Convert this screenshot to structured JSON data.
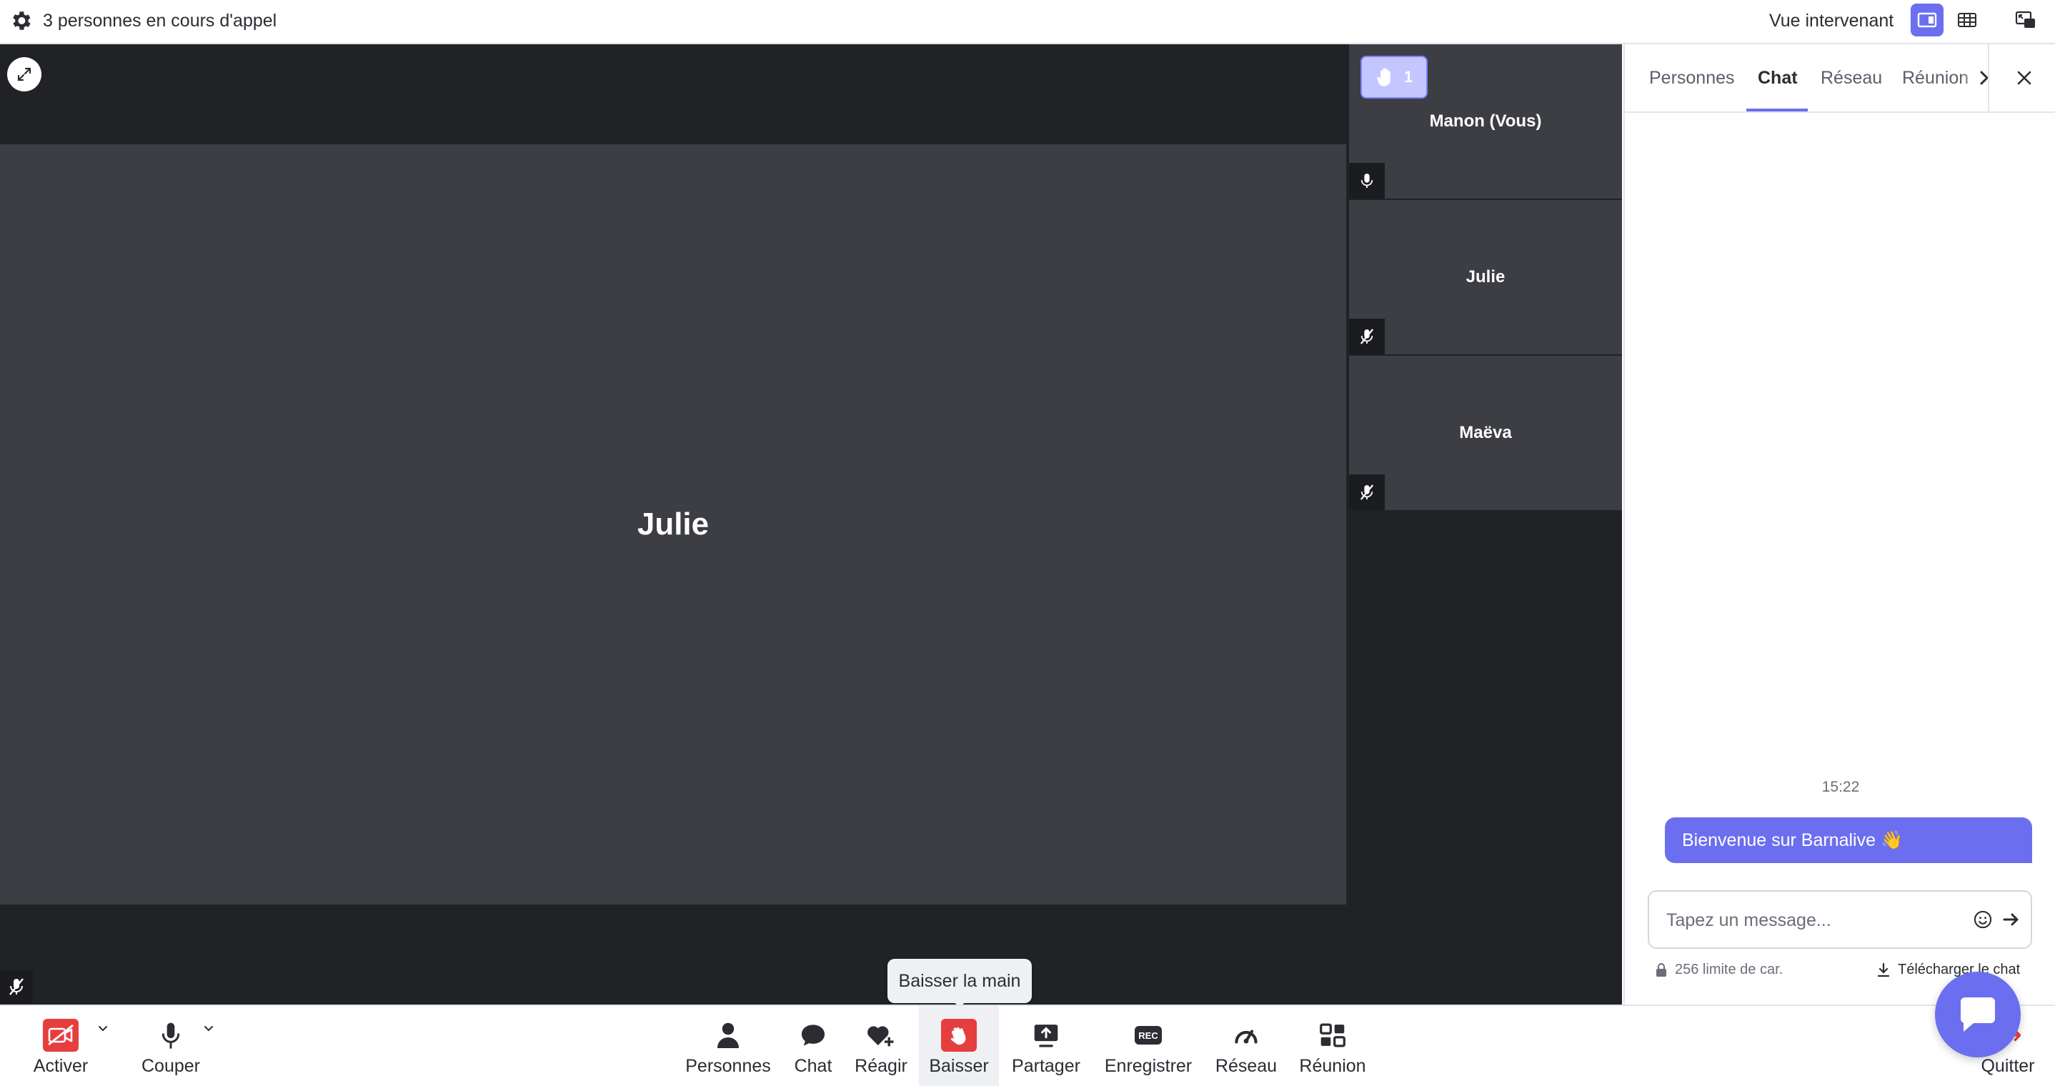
{
  "header": {
    "participant_count": "3 personnes en cours d'appel",
    "view_label": "Vue intervenant"
  },
  "stage": {
    "main_speaker": "Julie",
    "tiles": [
      {
        "name": "Manon (Vous)",
        "mic": "on"
      },
      {
        "name": "Julie",
        "mic": "muted"
      },
      {
        "name": "Maëva",
        "mic": "muted"
      }
    ],
    "raised_hands": "1"
  },
  "panel": {
    "tabs": [
      "Personnes",
      "Chat",
      "Réseau",
      "Réunion"
    ],
    "active_tab": "Chat",
    "chat": {
      "time": "15:22",
      "message": "Bienvenue sur Barnalive 👋",
      "input_placeholder": "Tapez un message...",
      "char_limit": "256 limite de car.",
      "download_label": "Télécharger le chat"
    }
  },
  "tooltip": "Baisser la main",
  "toolbar": {
    "camera_label": "Activer",
    "mic_label": "Couper",
    "people_label": "Personnes",
    "chat_label": "Chat",
    "react_label": "Réagir",
    "raise_label": "Baisser",
    "share_label": "Partager",
    "record_label": "Enregistrer",
    "network_label": "Réseau",
    "meeting_label": "Réunion",
    "quit_label": "Quitter",
    "record_badge": "REC"
  },
  "colors": {
    "accent": "#6b6fef",
    "danger": "#e53e3e",
    "stage_dark": "#212226",
    "tile": "#3d3e43"
  }
}
